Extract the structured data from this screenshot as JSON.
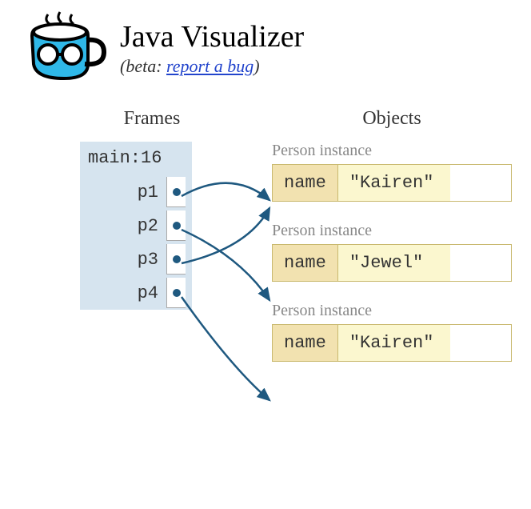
{
  "header": {
    "title": "Java Visualizer",
    "subtitle_prefix": "(beta: ",
    "subtitle_link": "report a bug",
    "subtitle_suffix": ")"
  },
  "columns": {
    "frames_label": "Frames",
    "objects_label": "Objects"
  },
  "frame": {
    "title": "main:16",
    "vars": [
      {
        "name": "p1"
      },
      {
        "name": "p2"
      },
      {
        "name": "p3"
      },
      {
        "name": "p4"
      }
    ]
  },
  "objects": [
    {
      "label": "Person instance",
      "key": "name",
      "value": "\"Kairen\""
    },
    {
      "label": "Person instance",
      "key": "name",
      "value": "\"Jewel\""
    },
    {
      "label": "Person instance",
      "key": "name",
      "value": "\"Kairen\""
    }
  ],
  "arrows": [
    {
      "from_var": "p1",
      "to_object": 0
    },
    {
      "from_var": "p2",
      "to_object": 1
    },
    {
      "from_var": "p3",
      "to_object": 0
    },
    {
      "from_var": "p4",
      "to_object": 2
    }
  ]
}
